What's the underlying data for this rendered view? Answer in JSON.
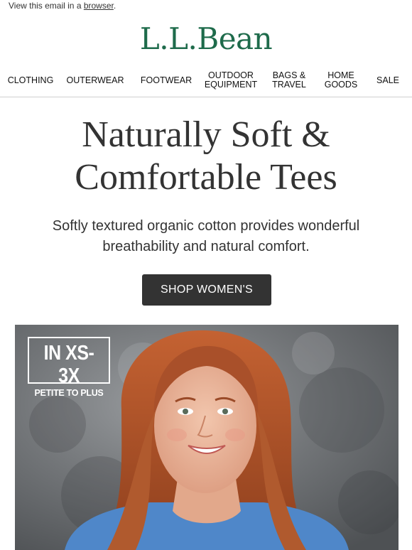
{
  "preheader": {
    "text": "View this email in a ",
    "link": "browser",
    "suffix": "."
  },
  "brand": {
    "logo": "L.L.Bean",
    "color": "#1e6b4b"
  },
  "nav": {
    "items": [
      {
        "label": "CLOTHING"
      },
      {
        "label": "OUTERWEAR"
      },
      {
        "label": "FOOTWEAR"
      },
      {
        "line1": "OUTDOOR",
        "line2": "EQUIPMENT"
      },
      {
        "line1": "BAGS &",
        "line2": "TRAVEL"
      },
      {
        "line1": "HOME",
        "line2": "GOODS"
      },
      {
        "label": "SALE"
      }
    ]
  },
  "hero_text": {
    "headline_line1": "Naturally Soft &",
    "headline_line2": "Comfortable Tees",
    "subcopy": "Softly textured organic cotton provides wonderful breathability and natural comfort."
  },
  "cta": {
    "label": "SHOP WOMEN'S",
    "color": "#333333"
  },
  "hero_image": {
    "badge_line1": "IN XS-3X",
    "badge_line2": "PETITE TO PLUS",
    "hair_color": "#b4532a",
    "shirt_color": "#4f87c9"
  }
}
